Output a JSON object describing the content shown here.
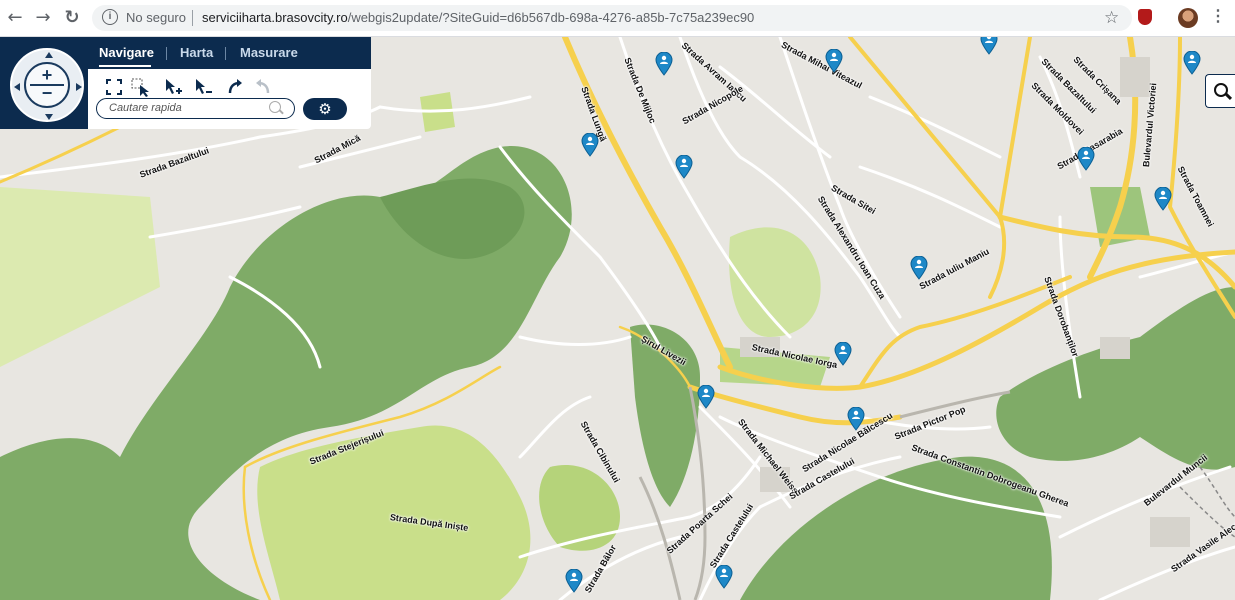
{
  "browser": {
    "back_icon": "arrow-left-icon",
    "forward_icon": "arrow-right-icon",
    "reload_icon": "reload-icon",
    "security_label": "No seguro",
    "url_host": "serviciiharta.brasovcity.ro",
    "url_path": "/webgis2update/?SiteGuid=d6b567db-698a-4276-a85b-7c75a239ec90"
  },
  "toolbar": {
    "tabs": [
      {
        "label": "Navigare",
        "active": true
      },
      {
        "label": "Harta",
        "active": false
      },
      {
        "label": "Masurare",
        "active": false
      }
    ],
    "zoom_in": "+",
    "zoom_out": "−",
    "tools": [
      "fullscreen-icon",
      "zoom-box-icon",
      "select-add-icon",
      "select-remove-icon",
      "undo-icon",
      "redo-icon"
    ],
    "search_placeholder": "Cautare rapida",
    "settings_icon": "gears-icon"
  },
  "map": {
    "colors": {
      "background": "#e8e6e1",
      "forest": "#7fab67",
      "park": "#c9df8a",
      "major_road": "#f6d04d",
      "minor_road": "#ffffff",
      "marker": "#1e88c7"
    },
    "streets": [
      {
        "name": "Strada Bazaltului"
      },
      {
        "name": "Strada Mică"
      },
      {
        "name": "Strada Lungă"
      },
      {
        "name": "Strada De Mijloc"
      },
      {
        "name": "Strada Avram Iancu"
      },
      {
        "name": "Strada Nicopole"
      },
      {
        "name": "Strada Mihai Viteazul"
      },
      {
        "name": "Strada Bazaltului"
      },
      {
        "name": "Strada Crișana"
      },
      {
        "name": "Strada Moldovei"
      },
      {
        "name": "Bulevardul Victoriei"
      },
      {
        "name": "Strada Basarabia"
      },
      {
        "name": "Strada Toamnei"
      },
      {
        "name": "Strada Sitei"
      },
      {
        "name": "Strada Alexandru Ioan Cuza"
      },
      {
        "name": "Strada Iuliu Maniu"
      },
      {
        "name": "Strada Dorobanților"
      },
      {
        "name": "Șirul Livezii"
      },
      {
        "name": "Strada Nicolae Iorga"
      },
      {
        "name": "Strada Stejerișului"
      },
      {
        "name": "Strada Cibinului"
      },
      {
        "name": "Strada Michael Weiss"
      },
      {
        "name": "Strada Nicolae Bălcescu"
      },
      {
        "name": "Strada Pictor Pop"
      },
      {
        "name": "Strada Constantin Dobrogeanu Gherea"
      },
      {
        "name": "Strada Castelului"
      },
      {
        "name": "Strada După Iniște"
      },
      {
        "name": "Strada Poarta Schei"
      },
      {
        "name": "Strada Castelului"
      },
      {
        "name": "Strada Bâlor"
      },
      {
        "name": "Bulevardul Muncii"
      },
      {
        "name": "Strada Vasile Alecsandri"
      }
    ],
    "side_search_icon": "search-icon",
    "marker_icon": "person-pin-icon"
  }
}
